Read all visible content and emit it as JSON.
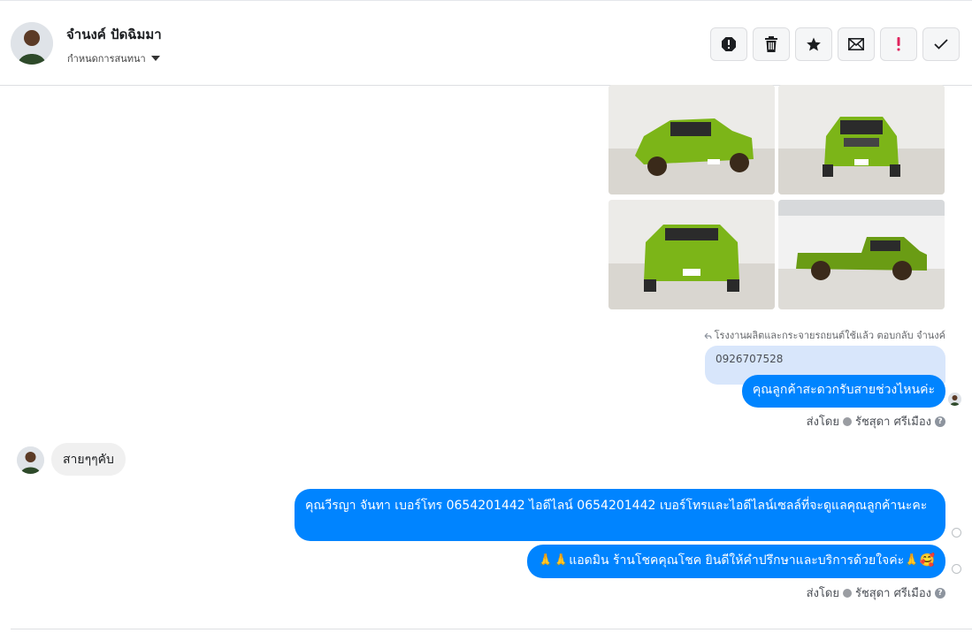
{
  "header": {
    "contact_name": "จำนงค์ ปัดฉิมมา",
    "conversation_label": "กำหนดการสนทนา",
    "actions": [
      {
        "name": "spam-button",
        "icon": "exclamation-circle-icon"
      },
      {
        "name": "delete-button",
        "icon": "trash-icon"
      },
      {
        "name": "star-button",
        "icon": "star-icon"
      },
      {
        "name": "mark-unread-button",
        "icon": "envelope-icon"
      },
      {
        "name": "important-button",
        "icon": "exclamation-icon"
      },
      {
        "name": "done-button",
        "icon": "check-icon"
      }
    ]
  },
  "thread": {
    "reply_info": "โรงงานผลิตและกระจายรถยนต์ใช้แล้ว ตอบกลับ จำนงค์",
    "quoted_text": "0926707528",
    "messages": {
      "m1": "คุณลูกค้าสะดวกรับสายช่วงไหนค่ะ",
      "incoming": "สายๆๆคับ",
      "m2": "คุณวีรญา จันทา       เบอร์โทร 0654201442  ไอดีไลน์ 0654201442   เบอร์โทรและไอดีไลน์เซลล์ที่จะดูแลคุณลูกค้านะคะ",
      "m3": "🙏🙏แอดมิน ร้านโชคคุณโชค ยินดีให้คำปรึกษาและบริการด้วยใจค่ะ🙏🥰"
    },
    "sent_by_label": "ส่งโดย",
    "sender_name": "รัชสุดา ศรีเมือง",
    "photos": [
      {
        "name": "photo-truck-front-left",
        "color": "#7cb518"
      },
      {
        "name": "photo-truck-front",
        "color": "#7cb518"
      },
      {
        "name": "photo-truck-rear",
        "color": "#7cb518"
      },
      {
        "name": "photo-truck-side",
        "color": "#6a9c14"
      }
    ]
  },
  "colors": {
    "outgoing_bubble": "#0084ff",
    "incoming_bubble": "#f0f0f0",
    "quote_bubble": "#d8e6fb"
  }
}
